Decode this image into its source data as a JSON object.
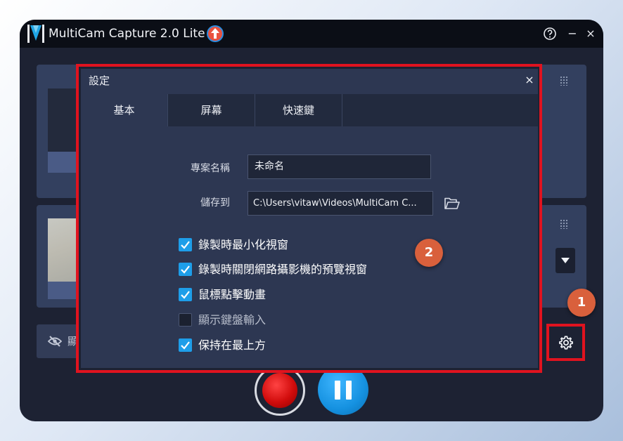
{
  "app": {
    "title": "MultiCam Capture 2.0 Lite",
    "accent_color": "#1591e0",
    "record_color": "#d10c0c",
    "highlight_color": "#e0131f",
    "badge_color": "#d9603c"
  },
  "window_controls": {
    "help_icon": "question-circle-icon",
    "minimize_label": "−",
    "close_label": "×"
  },
  "main": {
    "eye_row_text": "顯",
    "settings_icon": "gear-icon"
  },
  "badges": {
    "one": "1",
    "two": "2"
  },
  "dialog": {
    "title": "設定",
    "close_label": "×",
    "tabs": [
      {
        "label": "基本",
        "active": true
      },
      {
        "label": "屏幕",
        "active": false
      },
      {
        "label": "快速鍵",
        "active": false
      }
    ],
    "project_name": {
      "label": "專案名稱",
      "value": "未命名"
    },
    "save_to": {
      "label": "儲存到",
      "value": "C:\\Users\\vitaw\\Videos\\MultiCam C..."
    },
    "options": [
      {
        "label": "錄製時最小化視窗",
        "checked": true
      },
      {
        "label": "錄製時關閉網路攝影機的預覽視窗",
        "checked": true
      },
      {
        "label": "鼠標點擊動畫",
        "checked": true
      },
      {
        "label": "顯示鍵盤輸入",
        "checked": false
      },
      {
        "label": "保持在最上方",
        "checked": true
      }
    ]
  }
}
